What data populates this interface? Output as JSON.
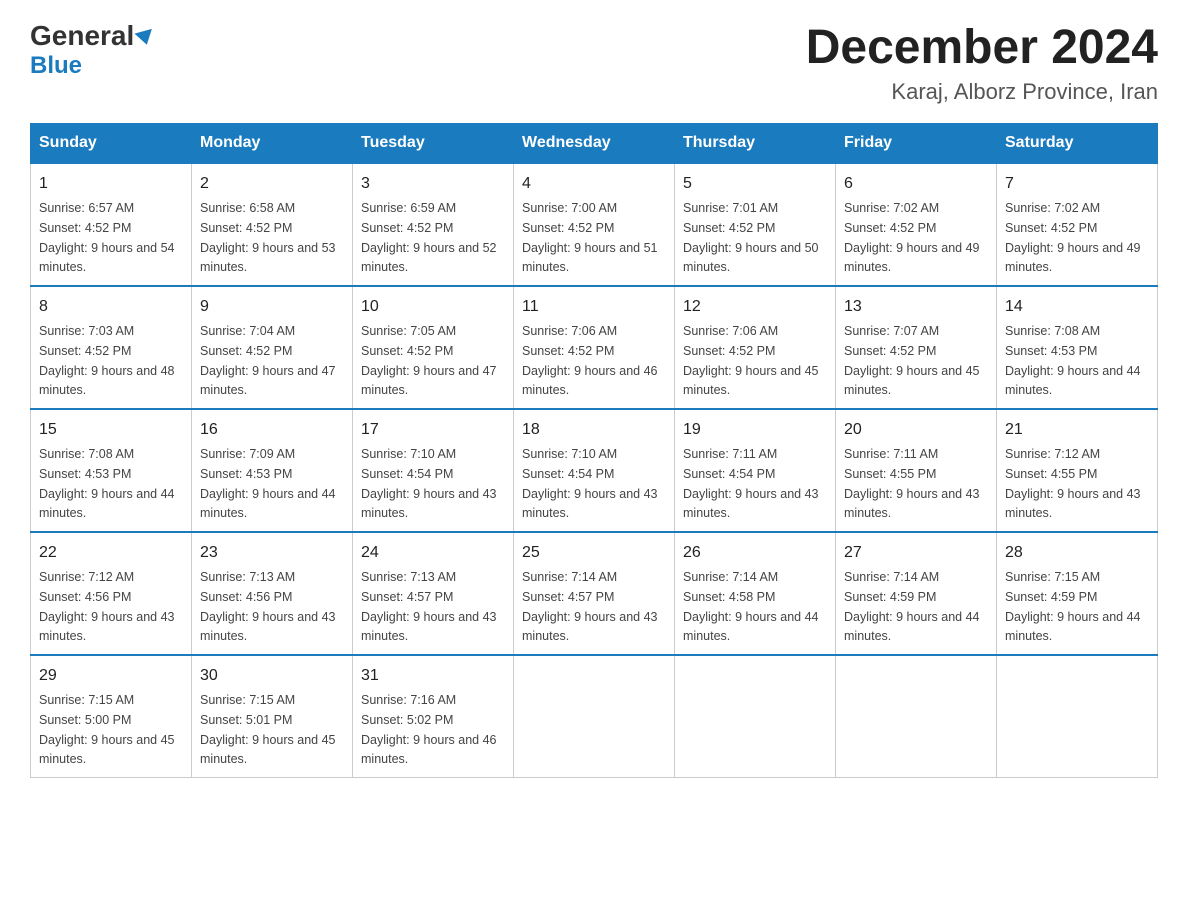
{
  "header": {
    "logo_general": "General",
    "logo_blue": "Blue",
    "title": "December 2024",
    "subtitle": "Karaj, Alborz Province, Iran"
  },
  "days_of_week": [
    "Sunday",
    "Monday",
    "Tuesday",
    "Wednesday",
    "Thursday",
    "Friday",
    "Saturday"
  ],
  "weeks": [
    [
      {
        "num": "1",
        "sunrise": "6:57 AM",
        "sunset": "4:52 PM",
        "daylight": "9 hours and 54 minutes."
      },
      {
        "num": "2",
        "sunrise": "6:58 AM",
        "sunset": "4:52 PM",
        "daylight": "9 hours and 53 minutes."
      },
      {
        "num": "3",
        "sunrise": "6:59 AM",
        "sunset": "4:52 PM",
        "daylight": "9 hours and 52 minutes."
      },
      {
        "num": "4",
        "sunrise": "7:00 AM",
        "sunset": "4:52 PM",
        "daylight": "9 hours and 51 minutes."
      },
      {
        "num": "5",
        "sunrise": "7:01 AM",
        "sunset": "4:52 PM",
        "daylight": "9 hours and 50 minutes."
      },
      {
        "num": "6",
        "sunrise": "7:02 AM",
        "sunset": "4:52 PM",
        "daylight": "9 hours and 49 minutes."
      },
      {
        "num": "7",
        "sunrise": "7:02 AM",
        "sunset": "4:52 PM",
        "daylight": "9 hours and 49 minutes."
      }
    ],
    [
      {
        "num": "8",
        "sunrise": "7:03 AM",
        "sunset": "4:52 PM",
        "daylight": "9 hours and 48 minutes."
      },
      {
        "num": "9",
        "sunrise": "7:04 AM",
        "sunset": "4:52 PM",
        "daylight": "9 hours and 47 minutes."
      },
      {
        "num": "10",
        "sunrise": "7:05 AM",
        "sunset": "4:52 PM",
        "daylight": "9 hours and 47 minutes."
      },
      {
        "num": "11",
        "sunrise": "7:06 AM",
        "sunset": "4:52 PM",
        "daylight": "9 hours and 46 minutes."
      },
      {
        "num": "12",
        "sunrise": "7:06 AM",
        "sunset": "4:52 PM",
        "daylight": "9 hours and 45 minutes."
      },
      {
        "num": "13",
        "sunrise": "7:07 AM",
        "sunset": "4:52 PM",
        "daylight": "9 hours and 45 minutes."
      },
      {
        "num": "14",
        "sunrise": "7:08 AM",
        "sunset": "4:53 PM",
        "daylight": "9 hours and 44 minutes."
      }
    ],
    [
      {
        "num": "15",
        "sunrise": "7:08 AM",
        "sunset": "4:53 PM",
        "daylight": "9 hours and 44 minutes."
      },
      {
        "num": "16",
        "sunrise": "7:09 AM",
        "sunset": "4:53 PM",
        "daylight": "9 hours and 44 minutes."
      },
      {
        "num": "17",
        "sunrise": "7:10 AM",
        "sunset": "4:54 PM",
        "daylight": "9 hours and 43 minutes."
      },
      {
        "num": "18",
        "sunrise": "7:10 AM",
        "sunset": "4:54 PM",
        "daylight": "9 hours and 43 minutes."
      },
      {
        "num": "19",
        "sunrise": "7:11 AM",
        "sunset": "4:54 PM",
        "daylight": "9 hours and 43 minutes."
      },
      {
        "num": "20",
        "sunrise": "7:11 AM",
        "sunset": "4:55 PM",
        "daylight": "9 hours and 43 minutes."
      },
      {
        "num": "21",
        "sunrise": "7:12 AM",
        "sunset": "4:55 PM",
        "daylight": "9 hours and 43 minutes."
      }
    ],
    [
      {
        "num": "22",
        "sunrise": "7:12 AM",
        "sunset": "4:56 PM",
        "daylight": "9 hours and 43 minutes."
      },
      {
        "num": "23",
        "sunrise": "7:13 AM",
        "sunset": "4:56 PM",
        "daylight": "9 hours and 43 minutes."
      },
      {
        "num": "24",
        "sunrise": "7:13 AM",
        "sunset": "4:57 PM",
        "daylight": "9 hours and 43 minutes."
      },
      {
        "num": "25",
        "sunrise": "7:14 AM",
        "sunset": "4:57 PM",
        "daylight": "9 hours and 43 minutes."
      },
      {
        "num": "26",
        "sunrise": "7:14 AM",
        "sunset": "4:58 PM",
        "daylight": "9 hours and 44 minutes."
      },
      {
        "num": "27",
        "sunrise": "7:14 AM",
        "sunset": "4:59 PM",
        "daylight": "9 hours and 44 minutes."
      },
      {
        "num": "28",
        "sunrise": "7:15 AM",
        "sunset": "4:59 PM",
        "daylight": "9 hours and 44 minutes."
      }
    ],
    [
      {
        "num": "29",
        "sunrise": "7:15 AM",
        "sunset": "5:00 PM",
        "daylight": "9 hours and 45 minutes."
      },
      {
        "num": "30",
        "sunrise": "7:15 AM",
        "sunset": "5:01 PM",
        "daylight": "9 hours and 45 minutes."
      },
      {
        "num": "31",
        "sunrise": "7:16 AM",
        "sunset": "5:02 PM",
        "daylight": "9 hours and 46 minutes."
      },
      null,
      null,
      null,
      null
    ]
  ]
}
